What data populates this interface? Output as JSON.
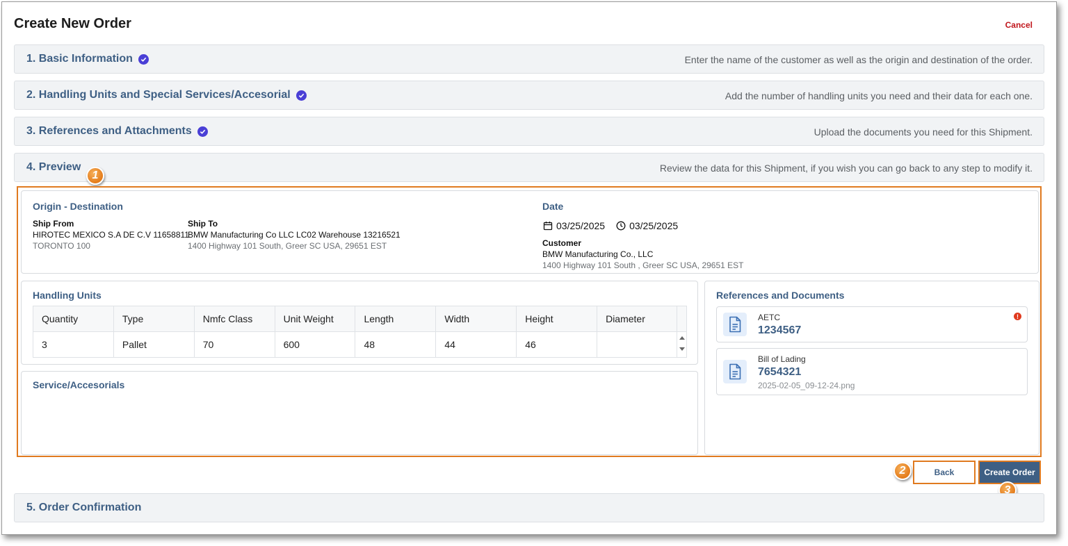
{
  "header": {
    "title": "Create New Order",
    "cancel_label": "Cancel"
  },
  "steps": [
    {
      "title": "1. Basic Information",
      "desc": "Enter the name of the customer as well as the origin and destination of the order.",
      "completed": true
    },
    {
      "title": "2. Handling Units and Special Services/Accesorial",
      "desc": "Add the number of handling units you need and their data for each one.",
      "completed": true
    },
    {
      "title": "3. References and Attachments",
      "desc": "Upload the documents you need for this Shipment.",
      "completed": true
    },
    {
      "title": "4. Preview",
      "desc": "Review the data for this Shipment, if you wish you can go back to any step to modify it.",
      "completed": false
    },
    {
      "title": "5. Order Confirmation",
      "desc": "",
      "completed": false
    }
  ],
  "preview": {
    "origin_destination": {
      "title": "Origin - Destination",
      "ship_from": {
        "label": "Ship From",
        "name": "HIROTEC MEXICO S.A DE C.V 11658811",
        "address": "TORONTO 100"
      },
      "ship_to": {
        "label": "Ship To",
        "name": "BMW Manufacturing Co LLC LC02 Warehouse 13216521",
        "address": "1400 Highway 101 South, Greer SC USA, 29651 EST"
      }
    },
    "date": {
      "title": "Date",
      "date_value": "03/25/2025",
      "time_value": "03/25/2025",
      "customer_label": "Customer",
      "customer_name": "BMW Manufacturing Co., LLC",
      "customer_address": "1400 Highway 101 South , Greer SC USA, 29651 EST"
    },
    "handling_units": {
      "title": "Handling Units",
      "columns": [
        "Quantity",
        "Type",
        "Nmfc Class",
        "Unit Weight",
        "Length",
        "Width",
        "Height",
        "Diameter"
      ],
      "rows": [
        [
          "3",
          "Pallet",
          "70",
          "600",
          "48",
          "44",
          "46",
          ""
        ]
      ]
    },
    "services": {
      "title": "Service/Accesorials"
    },
    "references": {
      "title": "References and Documents",
      "items": [
        {
          "type": "AETC",
          "number": "1234567",
          "file": "",
          "warning": "!"
        },
        {
          "type": "Bill of Lading",
          "number": "7654321",
          "file": "2025-02-05_09-12-24.png"
        }
      ]
    }
  },
  "actions": {
    "back_label": "Back",
    "create_label": "Create Order"
  },
  "callouts": [
    "1",
    "2",
    "3"
  ],
  "colors": {
    "accent": "#3e5f84",
    "check": "#4a3fd6",
    "highlight": "#e07a1f",
    "cancel": "#c0161c"
  }
}
